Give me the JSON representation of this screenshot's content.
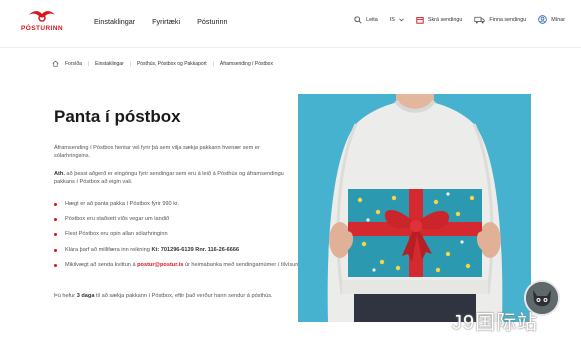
{
  "colors": {
    "brand_red": "#d7161f",
    "photo_bg": "#46b2cf",
    "gift_teal": "#2b9ab0"
  },
  "header": {
    "logo_text": "PÓSTURINN",
    "nav": [
      "Einstaklingar",
      "Fyrirtæki",
      "Pósturinn"
    ],
    "search_label": "Leita",
    "language": "IS",
    "register_label": "Skrá sendingu",
    "find_label": "Finna sendingu",
    "account_label": "Mínar"
  },
  "breadcrumb": [
    "Forsíða",
    "Einstaklingar",
    "Pósthús, Póstbox og Pakkaport",
    "Áframsending í Póstbox"
  ],
  "main": {
    "title": "Panta í póstbox",
    "intro": "Áframsending í Póstbox hentar vel fyrir þá sem vilja sækja pakkann hvenær sem er sólarhringsins.",
    "note_label": "Ath.",
    "note_text": " að þessi aðgerð er eingöngu fyrir sendingar sem eru á leið á Pósthús og áframsendingu pakkans í Póstbox að eigin vali.",
    "bullets": [
      "Hægt er að panta pakka í Póstbox fyrir 990 kr.",
      "Póstbox eru staðsett víðs vegar um landið",
      "Flest Póstbox eru opin allan sólarhringinn"
    ],
    "bullet4_prefix": "Klára þarf að millifæra inn reikning ",
    "bullet4_bold": "Kt: 701296-6139 Rnr. 116-26-6666",
    "bullet5_prefix": "Mikilvægt að senda kvittun á ",
    "bullet5_email": "postur@postur.is",
    "bullet5_suffix": " úr heimabanka með sendingarnúmer í tilvísun",
    "closing_prefix": "Þú hefur ",
    "closing_bold": "3 daga",
    "closing_suffix": " til að sækja pakkann í Póstbox, eftir það verður hann sendur á pósthús."
  },
  "watermark": "J9国际站",
  "icons": {
    "logo": "posturinn-logo",
    "search": "search-icon",
    "chevron": "chevron-down-icon",
    "register": "package-icon",
    "find": "truck-icon",
    "account": "user-icon",
    "home": "home-icon",
    "chat": "chat-avatar-icon"
  }
}
